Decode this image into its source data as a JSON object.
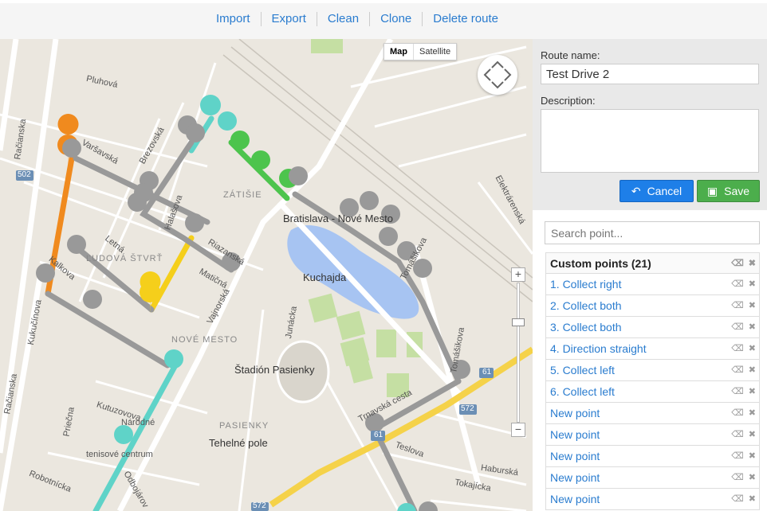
{
  "toolbar": {
    "items": [
      "Import",
      "Export",
      "Clean",
      "Clone",
      "Delete route"
    ]
  },
  "map": {
    "type_buttons": [
      "Map",
      "Satellite"
    ],
    "zoom_in": "+",
    "zoom_out": "−",
    "labels": {
      "pluhova": "Pluhová",
      "racianska": "Račianska",
      "varsavska": "Varšavská",
      "brezovska": "Brezovská",
      "zatisie": "ZÁTIŠIE",
      "bratislava": "Bratislava - Nové Mesto",
      "halasova": "Halašova",
      "letna": "Letná",
      "ludova": "ĽUDOVÁ ŠTVRŤ",
      "riazanska": "Riazanská",
      "maticna": "Matičná",
      "kalkova": "Kalkova",
      "kukucinova": "Kukučínova",
      "vajnorska": "Vajnorská",
      "kuchajda": "Kuchajda",
      "junacka": "Junácka",
      "tomasikova": "Tomášikova",
      "tomasikova2": "Tomášikova",
      "nove_mesto": "NOVÉ MESTO",
      "stadion": "Štadión Pasienky",
      "trnavska": "Trnavská cesta",
      "pasienky": "PASIENKY",
      "tehelne": "Tehelné pole",
      "kutuzovova": "Kutuzovova",
      "priecna": "Priečna",
      "narodne": "Národné",
      "tenisove": "tenisové centrum",
      "robotnicka": "Robotnícka",
      "odbojarov": "Odbojárov",
      "teslova": "Teslova",
      "haburska": "Haburská",
      "tokajicka": "Tokajícka",
      "elektrarenska": "Elektrárenská",
      "racianska2": "Račianska",
      "route502": "502",
      "route61": "61",
      "route61b": "61",
      "route572": "572",
      "route572b": "572"
    },
    "colors": {
      "road": "#ffffff",
      "highway": "#f5d249",
      "water": "#a7c4f2",
      "park": "#c5dfa3",
      "route_gray": "#999999",
      "route_orange": "#f08a1e",
      "route_yellow": "#f5cf1b",
      "route_green": "#4dc44d",
      "route_teal": "#5fd3c8"
    }
  },
  "form": {
    "route_name_label": "Route name:",
    "route_name_value": "Test Drive 2",
    "description_label": "Description:",
    "description_value": "",
    "cancel_label": "Cancel",
    "save_label": "Save"
  },
  "points": {
    "search_placeholder": "Search point...",
    "header": "Custom points (21)",
    "items": [
      "1. Collect right",
      "2. Collect both",
      "3. Collect both",
      "4. Direction straight",
      "5. Collect left",
      "6. Collect left",
      "New point",
      "New point",
      "New point",
      "New point",
      "New point"
    ]
  }
}
